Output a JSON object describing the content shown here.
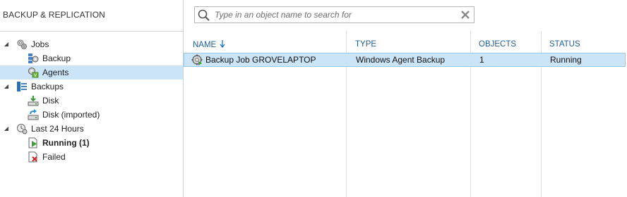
{
  "pane": {
    "title": "BACKUP & REPLICATION"
  },
  "tree": {
    "jobs": {
      "label": "Jobs",
      "expander": "◢"
    },
    "backup": {
      "label": "Backup"
    },
    "agents": {
      "label": "Agents"
    },
    "backups": {
      "label": "Backups",
      "expander": "◢"
    },
    "disk": {
      "label": "Disk"
    },
    "disk_imported": {
      "label": "Disk (imported)"
    },
    "last24": {
      "label": "Last 24 Hours",
      "expander": "◢"
    },
    "running": {
      "label": "Running (1)"
    },
    "failed": {
      "label": "Failed"
    }
  },
  "search": {
    "placeholder": "Type in an object name to search for",
    "value": ""
  },
  "table": {
    "columns": [
      "NAME",
      "TYPE",
      "OBJECTS",
      "STATUS"
    ],
    "rows": [
      {
        "name": "Backup Job GROVELAPTOP",
        "type": "Windows Agent Backup",
        "objects": "1",
        "status": "Running"
      }
    ]
  },
  "colors": {
    "selection": "#cce4f7",
    "header_text": "#1f5e99",
    "accent": "#1a74c4"
  },
  "icons": {
    "jobs": "gears-icon",
    "backup": "backup-job-icon",
    "agents": "agent-job-icon",
    "backups": "backups-icon",
    "disk": "disk-download-icon",
    "disk_imported": "disk-import-icon",
    "last24": "clock-gear-icon",
    "running": "running-play-icon",
    "failed": "failed-x-icon",
    "search": "search-icon",
    "clear": "clear-x-icon",
    "row": "job-gear-icon"
  }
}
